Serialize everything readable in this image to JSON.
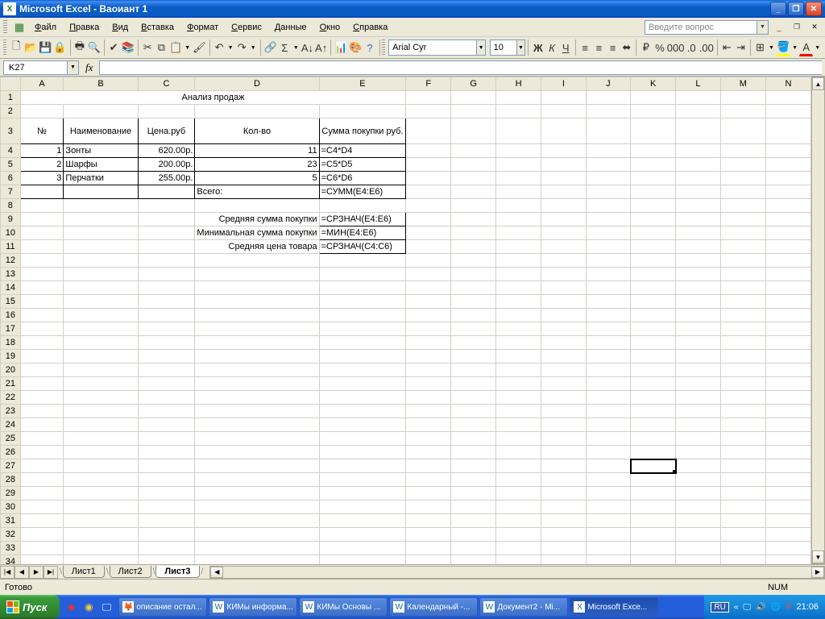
{
  "title": "Microsoft Excel - Ваоиант 1",
  "menu": {
    "file": "Файл",
    "edit": "Правка",
    "view": "Вид",
    "insert": "Вставка",
    "format": "Формат",
    "tools": "Сервис",
    "data": "Данные",
    "window": "Окно",
    "help": "Справка"
  },
  "question_placeholder": "Введите вопрос",
  "font": {
    "name": "Arial Cyr",
    "size": "10"
  },
  "namebox": "K27",
  "columns": [
    "A",
    "B",
    "C",
    "D",
    "E",
    "F",
    "G",
    "H",
    "I",
    "J",
    "K",
    "L",
    "M",
    "N"
  ],
  "rows_visible": 34,
  "selected_cell": {
    "row": 27,
    "col": "K"
  },
  "sheet_title": "Анализ продаж",
  "table": {
    "headers": {
      "n": "№",
      "name": "Наименование",
      "price": "Цена.руб",
      "qty": "Кол-во",
      "sum": "Сумма покупки руб."
    },
    "data": [
      {
        "n": "1",
        "name": "Зонты",
        "price": "620.00р.",
        "qty": "11",
        "sum": "=C4*D4"
      },
      {
        "n": "2",
        "name": "Шарфы",
        "price": "200.00р.",
        "qty": "23",
        "sum": "=C5*D5"
      },
      {
        "n": "3",
        "name": "Перчатки",
        "price": "255.00р.",
        "qty": "5",
        "sum": "=C6*D6"
      }
    ],
    "total_label": "Всего:",
    "total_formula": "=СУММ(E4:E6)"
  },
  "summary": [
    {
      "label": "Средняя сумма покупки",
      "formula": "=СРЗНАЧ(E4:E6)"
    },
    {
      "label": "Минимальная сумма покупки",
      "formula": "=МИН(E4:E6)"
    },
    {
      "label": "Средняя цена товара",
      "formula": "=СРЗНАЧ(C4:C6)"
    }
  ],
  "tabs": {
    "sheet1": "Лист1",
    "sheet2": "Лист2",
    "sheet3": "Лист3"
  },
  "status": {
    "ready": "Готово",
    "num": "NUM"
  },
  "taskbar": {
    "start": "Пуск",
    "items": [
      {
        "icon": "🦊",
        "label": "описание остал..."
      },
      {
        "icon": "W",
        "label": "КИМы информа..."
      },
      {
        "icon": "W",
        "label": "КИМы Основы ..."
      },
      {
        "icon": "W",
        "label": "Календарный -..."
      },
      {
        "icon": "W",
        "label": "Документ2 - Mi..."
      },
      {
        "icon": "X",
        "label": "Microsoft Exce..."
      }
    ],
    "clock": "21:06",
    "lang": "RU"
  }
}
